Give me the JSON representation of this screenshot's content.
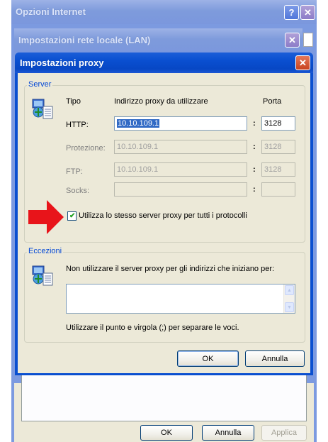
{
  "windows": {
    "outer": {
      "title": "Opzioni Internet",
      "ok": "OK",
      "cancel": "Annulla",
      "apply": "Applica"
    },
    "lan": {
      "title": "Impostazioni rete locale (LAN)"
    },
    "proxy": {
      "title": "Impostazioni proxy",
      "server_group": "Server",
      "col_type": "Tipo",
      "col_address": "Indirizzo proxy da utilizzare",
      "col_port": "Porta",
      "rows": [
        {
          "label": "HTTP:",
          "address": "10.10.109.1",
          "port": "3128",
          "enabled": true
        },
        {
          "label": "Protezione:",
          "address": "10.10.109.1",
          "port": "3128",
          "enabled": false
        },
        {
          "label": "FTP:",
          "address": "10.10.109.1",
          "port": "3128",
          "enabled": false
        },
        {
          "label": "Socks:",
          "address": "",
          "port": "",
          "enabled": false
        }
      ],
      "colon": ":",
      "same_proxy_label": "Utilizza lo stesso server proxy per tutti i protocolli",
      "same_proxy_checked": true,
      "exceptions_group": "Eccezioni",
      "exceptions_text": "Non utilizzare il server proxy per gli indirizzi che iniziano per:",
      "exceptions_value": "",
      "exceptions_hint": "Utilizzare il punto e virgola (;) per separare le voci.",
      "ok": "OK",
      "cancel": "Annulla"
    }
  },
  "colors": {
    "accent": "#0a4fd0",
    "arrow": "#e8141a",
    "legend": "#0046d5"
  }
}
